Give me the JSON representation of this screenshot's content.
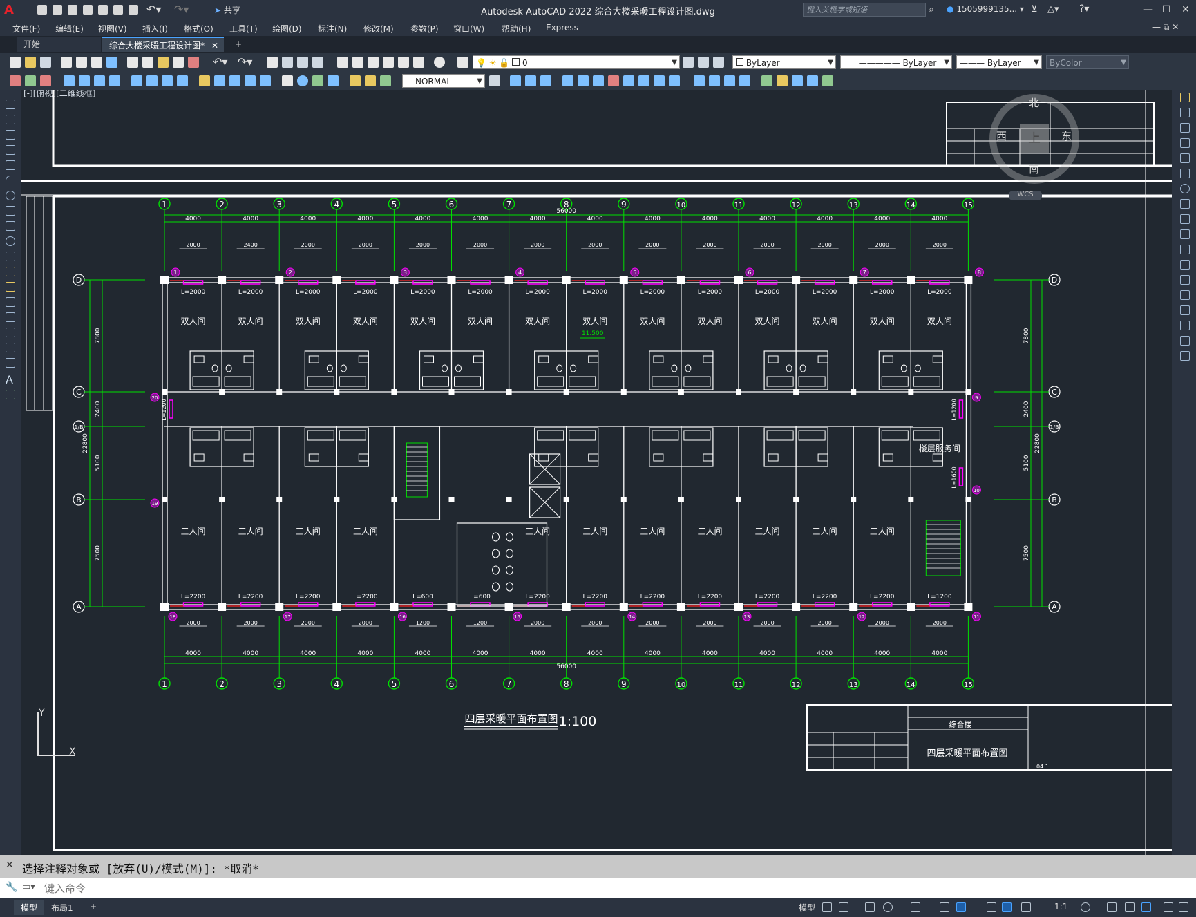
{
  "app": {
    "title": "Autodesk AutoCAD 2022    综合大楼采暖工程设计图.dwg",
    "share": "共享",
    "search_placeholder": "键入关键字或短语",
    "user": "1505999135...",
    "logo": "A"
  },
  "menu": [
    "文件(F)",
    "编辑(E)",
    "视图(V)",
    "插入(I)",
    "格式(O)",
    "工具(T)",
    "绘图(D)",
    "标注(N)",
    "修改(M)",
    "参数(P)",
    "窗口(W)",
    "帮助(H)",
    "Express"
  ],
  "tabs": {
    "start": "开始",
    "active": "综合大楼采暖工程设计图*"
  },
  "toolbar": {
    "layer": "0",
    "color": "ByLayer",
    "linetype": "ByLayer",
    "lineweight": "ByLayer",
    "plotstyle": "ByColor",
    "dimstyle": "NORMAL"
  },
  "viewport_label": "[-][俯视][二维线框]",
  "viewcube": {
    "n": "北",
    "s": "南",
    "e": "东",
    "w": "西",
    "top": "上",
    "wcs": "WCS"
  },
  "drawing": {
    "axes": [
      "1",
      "2",
      "3",
      "4",
      "5",
      "6",
      "7",
      "8",
      "9",
      "10",
      "11",
      "12",
      "13",
      "14",
      "15"
    ],
    "rows": [
      "D",
      "C",
      "1/B",
      "B",
      "A"
    ],
    "span": "4000",
    "total": "56000",
    "top_dims_r": [
      "2000",
      "2400",
      "2000",
      "2000",
      "2000",
      "2000",
      "2000",
      "2000",
      "2000",
      "2000",
      "2000",
      "2000",
      "2000",
      "2000",
      "2000",
      "2000"
    ],
    "radiator_top": [
      "L=2000",
      "L=2000",
      "L=2000",
      "L=2000",
      "L=2000",
      "L=2000",
      "L=2000",
      "L=2000",
      "L=2000",
      "L=2000",
      "L=2000",
      "L=2000",
      "L=2000",
      "L=2000"
    ],
    "radiator_bottom": [
      "L=2200",
      "L=2200",
      "L=2200",
      "L=2200",
      "L=600",
      "L=600",
      "L=2200",
      "L=2200",
      "L=2200",
      "L=2200",
      "L=2200",
      "L=2200",
      "L=2200",
      "L=1200"
    ],
    "room_double": "双人间",
    "room_triple": "三人间",
    "room_service": "楼层服务间",
    "elevation": "11.500",
    "left_dims": [
      "7800",
      "2400",
      "5100",
      "7500"
    ],
    "left_total": "22800",
    "side_rad": [
      "L=1200",
      "L=1200",
      "L=1600"
    ],
    "bottom_dims": [
      "2000",
      "2000",
      "2000",
      "2000",
      "1200",
      "1200",
      "2000",
      "2000",
      "2000",
      "2000",
      "2000",
      "2000",
      "2000",
      "2000",
      "2000"
    ],
    "markers_top": [
      "1",
      "2",
      "3",
      "4",
      "5",
      "6",
      "7",
      "8"
    ],
    "markers_bottom": [
      "18",
      "17",
      "16",
      "15",
      "14",
      "13",
      "12",
      "11"
    ],
    "markers_side": [
      "20",
      "19",
      "9",
      "10"
    ],
    "title": "四层采暖平面布置图",
    "scale": "1:100",
    "titleblock": {
      "project": "综合楼",
      "drawing": "四层采暖平面布置图",
      "no": "04.1"
    }
  },
  "command": {
    "history": "选择注释对象或 [放弃(U)/模式(M)]: *取消*",
    "placeholder": "键入命令"
  },
  "status": {
    "model_tab": "模型",
    "layout_tab": "布局1",
    "model": "模型",
    "scale": "1:1"
  },
  "colors": {
    "accent": "#2b3340",
    "grid": "#00e000",
    "wall": "#ffffff",
    "radiator": "#ff00ff",
    "pipe": "#ff2020"
  }
}
